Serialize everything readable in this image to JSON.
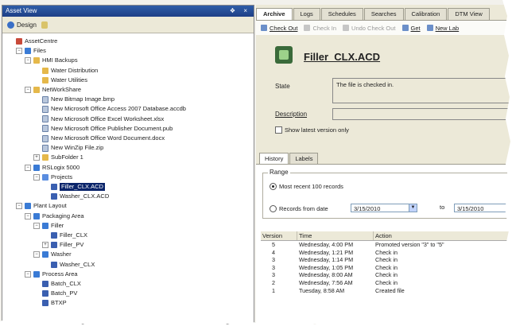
{
  "left_panel": {
    "title": "Asset View",
    "title_buttons": "❖ ×",
    "toolbar": {
      "design_label": "Design"
    },
    "tree": [
      {
        "label": "AssetCentre",
        "icon": "root-icon",
        "level": 0,
        "expander": ""
      },
      {
        "label": "Files",
        "icon": "server-icon",
        "level": 1,
        "expander": "−"
      },
      {
        "label": "HMI Backups",
        "icon": "folder-icon",
        "level": 2,
        "expander": "−"
      },
      {
        "label": "Water Distribution",
        "icon": "folder-icon",
        "level": 3,
        "expander": ""
      },
      {
        "label": "Water Utilities",
        "icon": "folder-icon",
        "level": 3,
        "expander": ""
      },
      {
        "label": "NetWorkShare",
        "icon": "folder-icon",
        "level": 2,
        "expander": "−"
      },
      {
        "label": "New Bitmap Image.bmp",
        "icon": "document-icon",
        "level": 3,
        "expander": ""
      },
      {
        "label": "New Microsoft Office Access 2007 Database.accdb",
        "icon": "document-icon",
        "level": 3,
        "expander": ""
      },
      {
        "label": "New Microsoft Office Excel Worksheet.xlsx",
        "icon": "document-icon",
        "level": 3,
        "expander": ""
      },
      {
        "label": "New Microsoft Office Publisher Document.pub",
        "icon": "document-icon",
        "level": 3,
        "expander": ""
      },
      {
        "label": "New Microsoft Office Word Document.docx",
        "icon": "document-icon",
        "level": 3,
        "expander": ""
      },
      {
        "label": "New WinZip File.zip",
        "icon": "document-icon",
        "level": 3,
        "expander": ""
      },
      {
        "label": "SubFolder 1",
        "icon": "folder-icon",
        "level": 3,
        "expander": "+"
      },
      {
        "label": "RSLogix 5000",
        "icon": "server-icon",
        "level": 2,
        "expander": "−"
      },
      {
        "label": "Projects",
        "icon": "project-icon",
        "level": 3,
        "expander": "−"
      },
      {
        "label": "Filler_CLX.ACD",
        "icon": "controller-file-icon",
        "level": 4,
        "expander": "",
        "selected": true
      },
      {
        "label": "Washer_CLX.ACD",
        "icon": "controller-file-icon",
        "level": 4,
        "expander": ""
      },
      {
        "label": "Plant Layout",
        "icon": "server-icon",
        "level": 1,
        "expander": "−"
      },
      {
        "label": "Packaging Area",
        "icon": "server-icon",
        "level": 2,
        "expander": "−"
      },
      {
        "label": "Filler",
        "icon": "server-icon",
        "level": 3,
        "expander": "−"
      },
      {
        "label": "Filler_CLX",
        "icon": "controller-icon",
        "level": 4,
        "expander": ""
      },
      {
        "label": "Filler_PV",
        "icon": "controller-icon",
        "level": 4,
        "expander": "+"
      },
      {
        "label": "Washer",
        "icon": "server-icon",
        "level": 3,
        "expander": "−"
      },
      {
        "label": "Washer_CLX",
        "icon": "controller-icon",
        "level": 4,
        "expander": ""
      },
      {
        "label": "Process Area",
        "icon": "server-icon",
        "level": 2,
        "expander": "−"
      },
      {
        "label": "Batch_CLX",
        "icon": "controller-icon",
        "level": 3,
        "expander": ""
      },
      {
        "label": "Batch_PV",
        "icon": "controller-icon",
        "level": 3,
        "expander": ""
      },
      {
        "label": "BTXP",
        "icon": "controller-icon",
        "level": 3,
        "expander": ""
      }
    ]
  },
  "right_panel": {
    "tabs": [
      "Archive",
      "Logs",
      "Schedules",
      "Searches",
      "Calibration",
      "DTM View"
    ],
    "toolbar": {
      "check_out": "Check Out",
      "check_in": "Check In",
      "undo_check_out": "Undo Check Out",
      "get": "Get",
      "new_label": "New Lab"
    },
    "file": {
      "name": "Filler_CLX.ACD",
      "state_label": "State",
      "state_value": "The file is checked in.",
      "description_label": "Description",
      "show_latest_label": "Show latest version only"
    },
    "subtabs": [
      "History",
      "Labels"
    ],
    "range": {
      "title": "Range",
      "most_recent": "Most recent 100 records",
      "records_from": "Records from date",
      "from_date": "3/15/2010",
      "to_label": "to",
      "to_date": "3/15/2010"
    },
    "history": {
      "headers": [
        "Version",
        "Time",
        "Action"
      ],
      "rows": [
        {
          "version": "5",
          "time": "Wednesday, 4:00 PM",
          "action": "Promoted version \"3\" to \"5\""
        },
        {
          "version": "4",
          "time": "Wednesday, 1:21 PM",
          "action": "Check in"
        },
        {
          "version": "3",
          "time": "Wednesday, 1:14 PM",
          "action": "Check in"
        },
        {
          "version": "3",
          "time": "Wednesday, 1:05 PM",
          "action": "Check in"
        },
        {
          "version": "3",
          "time": "Wednesday, 8:00 AM",
          "action": "Check in"
        },
        {
          "version": "2",
          "time": "Wednesday, 7:56 AM",
          "action": "Check in"
        },
        {
          "version": "1",
          "time": "Tuesday, 8:58 AM",
          "action": "Created file"
        }
      ]
    }
  },
  "colors": {
    "title_bar": "#1e3f86",
    "selection": "#0a246a",
    "panel_bg": "#ece9d8"
  }
}
